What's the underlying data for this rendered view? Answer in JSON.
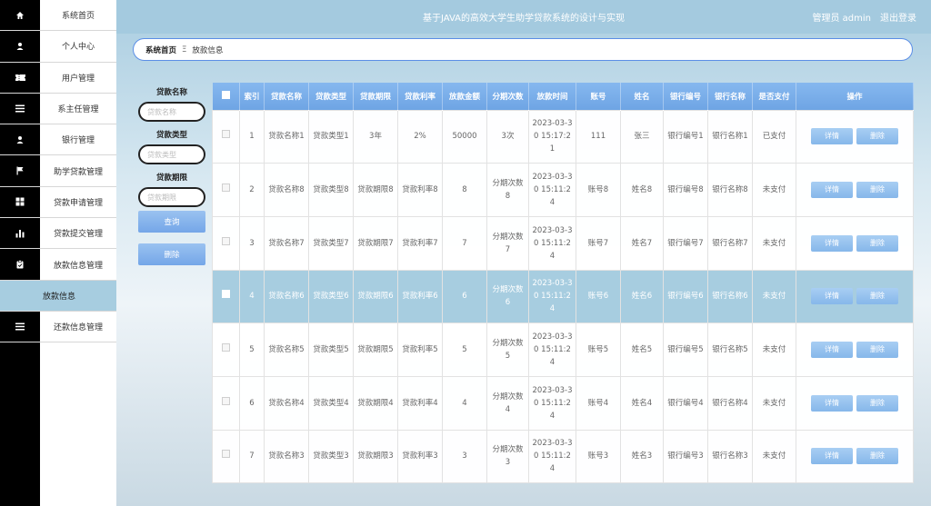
{
  "header": {
    "title": "基于JAVA的高效大学生助学贷款系统的设计与实现",
    "user": "管理员 admin",
    "logout": "退出登录"
  },
  "sidebar": {
    "items": [
      {
        "label": "系统首页",
        "icon": "home-icon"
      },
      {
        "label": "个人中心",
        "icon": "user-icon"
      },
      {
        "label": "用户管理",
        "icon": "ticket-icon"
      },
      {
        "label": "系主任管理",
        "icon": "list-icon"
      },
      {
        "label": "银行管理",
        "icon": "user-icon"
      },
      {
        "label": "助学贷款管理",
        "icon": "flag-icon"
      },
      {
        "label": "贷款申请管理",
        "icon": "grid-icon"
      },
      {
        "label": "贷款提交管理",
        "icon": "bar-chart-icon"
      },
      {
        "label": "放款信息管理",
        "icon": "clipboard-icon"
      },
      {
        "label": "放款信息",
        "icon": "",
        "sub": true
      },
      {
        "label": "还款信息管理",
        "icon": "list-icon"
      }
    ]
  },
  "breadcrumb": {
    "home": "系统首页",
    "sep": "Ξ",
    "current": "放款信息"
  },
  "filters": {
    "name_label": "贷款名称",
    "name_placeholder": "贷款名称",
    "type_label": "贷款类型",
    "type_placeholder": "贷款类型",
    "term_label": "贷款期限",
    "term_placeholder": "贷款期限",
    "search_label": "查询",
    "delete_label": "删除"
  },
  "table": {
    "headers": [
      "索引",
      "贷款名称",
      "贷款类型",
      "贷款期限",
      "贷款利率",
      "放款金额",
      "分期次数",
      "放款时间",
      "账号",
      "姓名",
      "银行编号",
      "银行名称",
      "是否支付",
      "操作"
    ],
    "detail_label": "详情",
    "delete_label": "删除",
    "rows": [
      [
        "1",
        "贷款名称1",
        "贷款类型1",
        "3年",
        "2%",
        "50000",
        "3次",
        "2023-03-30 15:17:21",
        "111",
        "张三",
        "银行编号1",
        "银行名称1",
        "已支付"
      ],
      [
        "2",
        "贷款名称8",
        "贷款类型8",
        "贷款期限8",
        "贷款利率8",
        "8",
        "分期次数8",
        "2023-03-30 15:11:24",
        "账号8",
        "姓名8",
        "银行编号8",
        "银行名称8",
        "未支付"
      ],
      [
        "3",
        "贷款名称7",
        "贷款类型7",
        "贷款期限7",
        "贷款利率7",
        "7",
        "分期次数7",
        "2023-03-30 15:11:24",
        "账号7",
        "姓名7",
        "银行编号7",
        "银行名称7",
        "未支付"
      ],
      [
        "4",
        "贷款名称6",
        "贷款类型6",
        "贷款期限6",
        "贷款利率6",
        "6",
        "分期次数6",
        "2023-03-30 15:11:24",
        "账号6",
        "姓名6",
        "银行编号6",
        "银行名称6",
        "未支付"
      ],
      [
        "5",
        "贷款名称5",
        "贷款类型5",
        "贷款期限5",
        "贷款利率5",
        "5",
        "分期次数5",
        "2023-03-30 15:11:24",
        "账号5",
        "姓名5",
        "银行编号5",
        "银行名称5",
        "未支付"
      ],
      [
        "6",
        "贷款名称4",
        "贷款类型4",
        "贷款期限4",
        "贷款利率4",
        "4",
        "分期次数4",
        "2023-03-30 15:11:24",
        "账号4",
        "姓名4",
        "银行编号4",
        "银行名称4",
        "未支付"
      ],
      [
        "7",
        "贷款名称3",
        "贷款类型3",
        "贷款期限3",
        "贷款利率3",
        "3",
        "分期次数3",
        "2023-03-30 15:11:24",
        "账号3",
        "姓名3",
        "银行编号3",
        "银行名称3",
        "未支付"
      ]
    ]
  }
}
